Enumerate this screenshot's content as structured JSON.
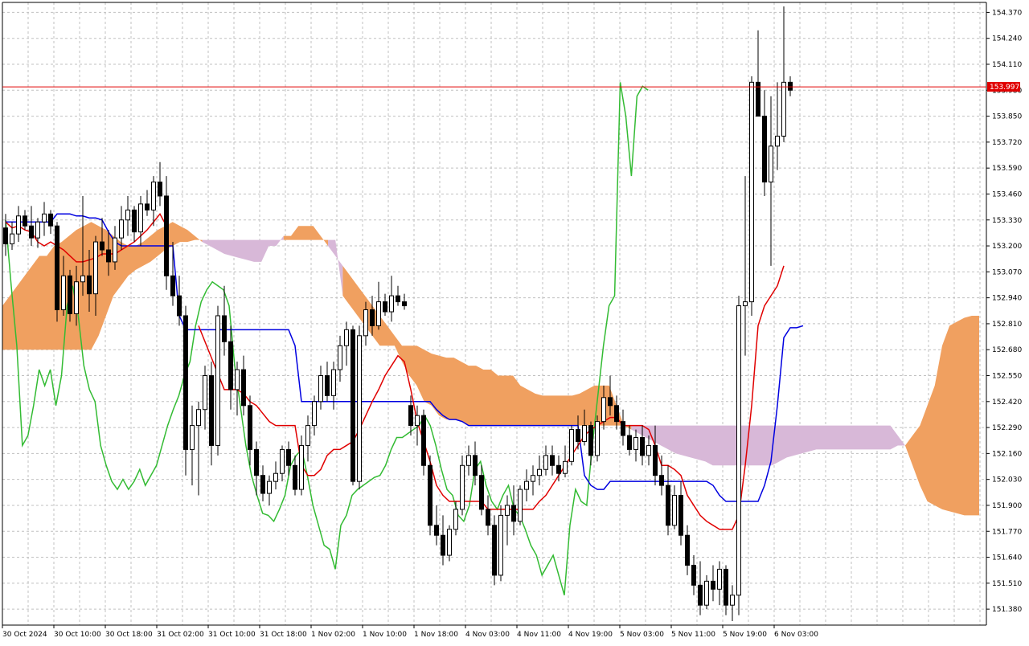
{
  "chart_data": {
    "type": "candlestick",
    "indicator": "ichimoku",
    "grid": true,
    "ylim": [
      151.3,
      154.42
    ],
    "y_ticks": [
      "154.370",
      "154.240",
      "154.110",
      "153.980",
      "153.850",
      "153.720",
      "153.590",
      "153.460",
      "153.330",
      "153.200",
      "153.070",
      "152.940",
      "152.810",
      "152.680",
      "152.550",
      "152.420",
      "152.290",
      "152.160",
      "152.030",
      "151.900",
      "151.770",
      "151.640",
      "151.510",
      "151.380"
    ],
    "x_ticks": [
      "30 Oct 2024",
      "30 Oct 10:00",
      "30 Oct 18:00",
      "31 Oct 02:00",
      "31 Oct 10:00",
      "31 Oct 18:00",
      "1 Nov 02:00",
      "1 Nov 10:00",
      "1 Nov 18:00",
      "4 Nov 03:00",
      "4 Nov 11:00",
      "4 Nov 19:00",
      "5 Nov 03:00",
      "5 Nov 11:00",
      "5 Nov 19:00",
      "6 Nov 03:00"
    ],
    "current_price": 153.997,
    "current_price_label": "153.997",
    "colors": {
      "tenkan": "#e00000",
      "kijun": "#0000e0",
      "chikou": "#33bb33",
      "cloud_bull": "#f0a060",
      "cloud_bear": "#d8b8d8",
      "price_line": "#e00000",
      "candle": "#000000",
      "grid": "#c0c0c0"
    },
    "candles": [
      [
        153.29,
        153.36,
        153.15,
        153.21
      ],
      [
        153.21,
        153.32,
        153.18,
        153.26
      ],
      [
        153.26,
        153.4,
        153.22,
        153.35
      ],
      [
        153.35,
        153.38,
        153.28,
        153.3
      ],
      [
        153.3,
        153.4,
        153.2,
        153.24
      ],
      [
        153.24,
        153.34,
        153.19,
        153.32
      ],
      [
        153.32,
        153.42,
        153.25,
        153.36
      ],
      [
        153.36,
        153.38,
        153.26,
        153.3
      ],
      [
        153.3,
        153.32,
        152.82,
        152.88
      ],
      [
        152.88,
        153.15,
        152.85,
        153.05
      ],
      [
        153.05,
        153.08,
        152.82,
        152.86
      ],
      [
        152.86,
        153.1,
        152.8,
        153.02
      ],
      [
        153.02,
        153.45,
        152.95,
        153.05
      ],
      [
        153.05,
        153.18,
        152.87,
        152.96
      ],
      [
        152.96,
        153.25,
        152.85,
        153.22
      ],
      [
        153.22,
        153.34,
        153.15,
        153.18
      ],
      [
        153.18,
        153.28,
        153.05,
        153.12
      ],
      [
        153.12,
        153.3,
        153.08,
        153.24
      ],
      [
        153.24,
        153.4,
        153.18,
        153.33
      ],
      [
        153.33,
        153.45,
        153.25,
        153.38
      ],
      [
        153.38,
        153.4,
        153.22,
        153.27
      ],
      [
        153.27,
        153.45,
        153.2,
        153.41
      ],
      [
        153.41,
        153.48,
        153.35,
        153.38
      ],
      [
        153.38,
        153.55,
        153.3,
        153.52
      ],
      [
        153.52,
        153.62,
        153.4,
        153.45
      ],
      [
        153.45,
        153.55,
        152.98,
        153.05
      ],
      [
        153.05,
        153.22,
        152.9,
        152.95
      ],
      [
        152.95,
        153.05,
        152.8,
        152.85
      ],
      [
        152.85,
        152.9,
        152.05,
        152.18
      ],
      [
        152.18,
        152.4,
        152.0,
        152.3
      ],
      [
        152.3,
        152.42,
        151.95,
        152.38
      ],
      [
        152.38,
        152.6,
        152.28,
        152.55
      ],
      [
        152.55,
        152.62,
        152.1,
        152.2
      ],
      [
        152.2,
        152.9,
        152.15,
        152.85
      ],
      [
        152.85,
        153.0,
        152.65,
        152.72
      ],
      [
        152.72,
        152.8,
        152.38,
        152.48
      ],
      [
        152.48,
        152.62,
        152.35,
        152.58
      ],
      [
        152.58,
        152.65,
        152.35,
        152.4
      ],
      [
        152.4,
        152.45,
        152.1,
        152.18
      ],
      [
        152.18,
        152.22,
        151.95,
        152.05
      ],
      [
        152.05,
        152.1,
        151.92,
        151.96
      ],
      [
        151.96,
        152.05,
        151.9,
        152.02
      ],
      [
        152.02,
        152.12,
        151.98,
        152.06
      ],
      [
        152.06,
        152.2,
        152.02,
        152.18
      ],
      [
        152.18,
        152.22,
        152.05,
        152.1
      ],
      [
        152.1,
        152.15,
        151.95,
        151.98
      ],
      [
        151.98,
        152.25,
        151.95,
        152.2
      ],
      [
        152.2,
        152.35,
        152.12,
        152.3
      ],
      [
        152.3,
        152.45,
        152.25,
        152.42
      ],
      [
        152.42,
        152.6,
        152.38,
        152.55
      ],
      [
        152.55,
        152.62,
        152.42,
        152.45
      ],
      [
        152.45,
        152.62,
        152.38,
        152.58
      ],
      [
        152.58,
        152.75,
        152.52,
        152.7
      ],
      [
        152.7,
        152.82,
        152.6,
        152.78
      ],
      [
        152.78,
        152.8,
        152.0,
        152.02
      ],
      [
        152.02,
        152.8,
        151.98,
        152.75
      ],
      [
        152.75,
        152.92,
        152.7,
        152.88
      ],
      [
        152.88,
        152.95,
        152.75,
        152.8
      ],
      [
        152.8,
        153.02,
        152.78,
        152.92
      ],
      [
        152.92,
        152.96,
        152.85,
        152.87
      ],
      [
        152.87,
        153.05,
        152.82,
        152.95
      ],
      [
        152.95,
        153.0,
        152.9,
        152.92
      ],
      [
        152.92,
        152.96,
        152.88,
        152.9
      ],
      [
        152.4,
        152.45,
        152.25,
        152.3
      ],
      [
        152.3,
        152.4,
        152.2,
        152.35
      ],
      [
        152.35,
        152.38,
        152.05,
        152.1
      ],
      [
        152.1,
        152.15,
        151.75,
        151.8
      ],
      [
        151.8,
        151.9,
        151.7,
        151.75
      ],
      [
        151.75,
        151.85,
        151.6,
        151.65
      ],
      [
        151.65,
        151.8,
        151.62,
        151.78
      ],
      [
        151.78,
        151.92,
        151.75,
        151.88
      ],
      [
        151.88,
        152.15,
        151.85,
        152.1
      ],
      [
        152.1,
        152.2,
        152.05,
        152.15
      ],
      [
        152.15,
        152.22,
        152.0,
        152.05
      ],
      [
        152.05,
        152.1,
        151.85,
        151.88
      ],
      [
        151.88,
        151.95,
        151.75,
        151.8
      ],
      [
        151.8,
        151.85,
        151.5,
        151.55
      ],
      [
        151.55,
        151.9,
        151.52,
        151.85
      ],
      [
        151.85,
        151.95,
        151.7,
        151.9
      ],
      [
        151.9,
        152.0,
        151.75,
        151.82
      ],
      [
        151.82,
        152.0,
        151.8,
        151.98
      ],
      [
        151.98,
        152.08,
        151.92,
        152.02
      ],
      [
        152.02,
        152.1,
        151.95,
        152.05
      ],
      [
        152.05,
        152.15,
        152.0,
        152.08
      ],
      [
        152.08,
        152.2,
        152.05,
        152.15
      ],
      [
        152.15,
        152.2,
        152.05,
        152.1
      ],
      [
        152.1,
        152.15,
        152.02,
        152.06
      ],
      [
        152.06,
        152.2,
        152.04,
        152.12
      ],
      [
        152.12,
        152.3,
        152.1,
        152.28
      ],
      [
        152.28,
        152.35,
        152.18,
        152.22
      ],
      [
        152.22,
        152.38,
        152.2,
        152.3
      ],
      [
        152.3,
        152.32,
        152.1,
        152.15
      ],
      [
        152.15,
        152.35,
        152.12,
        152.32
      ],
      [
        152.32,
        152.5,
        152.28,
        152.44
      ],
      [
        152.44,
        152.55,
        152.35,
        152.4
      ],
      [
        152.4,
        152.45,
        152.28,
        152.32
      ],
      [
        152.32,
        152.38,
        152.2,
        152.25
      ],
      [
        152.25,
        152.3,
        152.15,
        152.18
      ],
      [
        152.18,
        152.28,
        152.12,
        152.24
      ],
      [
        152.24,
        152.3,
        152.1,
        152.15
      ],
      [
        152.15,
        152.25,
        152.1,
        152.2
      ],
      [
        152.2,
        152.3,
        152.0,
        152.05
      ],
      [
        152.05,
        152.15,
        151.95,
        152.0
      ],
      [
        152.0,
        152.1,
        151.75,
        151.8
      ],
      [
        151.8,
        152.0,
        151.78,
        151.95
      ],
      [
        151.95,
        152.02,
        151.7,
        151.75
      ],
      [
        151.75,
        151.8,
        151.55,
        151.6
      ],
      [
        151.6,
        151.65,
        151.45,
        151.5
      ],
      [
        151.5,
        151.62,
        151.35,
        151.4
      ],
      [
        151.4,
        151.55,
        151.38,
        151.52
      ],
      [
        151.52,
        151.6,
        151.42,
        151.48
      ],
      [
        151.48,
        151.62,
        151.4,
        151.58
      ],
      [
        151.58,
        151.6,
        151.35,
        151.4
      ],
      [
        151.4,
        151.5,
        151.32,
        151.45
      ],
      [
        151.45,
        152.95,
        151.35,
        152.9
      ],
      [
        152.9,
        153.55,
        152.65,
        152.92
      ],
      [
        152.92,
        154.05,
        152.85,
        154.02
      ],
      [
        154.02,
        154.28,
        153.85,
        153.85
      ],
      [
        153.85,
        153.98,
        153.45,
        153.52
      ],
      [
        153.52,
        153.95,
        153.1,
        153.7
      ],
      [
        153.7,
        154.02,
        153.58,
        153.75
      ],
      [
        153.75,
        154.4,
        153.72,
        154.02
      ],
      [
        154.02,
        154.05,
        153.95,
        153.98
      ]
    ],
    "tenkan": [
      153.32,
      153.29,
      153.3,
      153.28,
      153.27,
      153.22,
      153.2,
      153.22,
      153.2,
      153.18,
      153.15,
      153.12,
      153.12,
      153.13,
      153.14,
      153.16,
      153.16,
      153.16,
      153.18,
      153.2,
      153.22,
      153.25,
      153.28,
      153.32,
      153.36,
      153.3,
      null,
      null,
      null,
      null,
      152.8,
      152.72,
      152.64,
      152.56,
      152.48,
      152.48,
      152.48,
      152.46,
      152.42,
      152.4,
      152.36,
      152.32,
      152.3,
      152.3,
      152.3,
      152.3,
      152.1,
      152.05,
      152.05,
      152.08,
      152.15,
      152.18,
      152.18,
      152.2,
      152.22,
      152.28,
      152.35,
      152.42,
      152.48,
      152.55,
      152.6,
      152.65,
      152.62,
      152.48,
      152.32,
      152.22,
      152.12,
      152.0,
      151.95,
      151.92,
      151.92,
      151.92,
      151.92,
      151.92,
      151.92,
      151.88,
      151.88,
      151.88,
      151.88,
      151.88,
      151.88,
      151.88,
      151.88,
      151.92,
      151.95,
      152.0,
      152.05,
      152.1,
      152.15,
      152.2,
      152.25,
      152.28,
      152.3,
      152.32,
      152.34,
      152.34,
      152.3,
      152.3,
      152.3,
      152.3,
      152.28,
      152.2,
      152.1,
      152.1,
      152.08,
      152.05,
      151.95,
      151.9,
      151.85,
      151.82,
      151.8,
      151.78,
      151.78,
      151.78,
      151.85,
      152.1,
      152.4,
      152.8,
      152.9,
      152.95,
      153.0,
      153.1,
      null
    ],
    "kijun": [
      153.32,
      153.32,
      153.32,
      153.32,
      153.32,
      153.32,
      153.32,
      153.32,
      153.36,
      153.36,
      153.36,
      153.35,
      153.35,
      153.34,
      153.34,
      153.33,
      153.27,
      153.22,
      153.2,
      153.2,
      153.2,
      153.2,
      153.2,
      153.2,
      153.2,
      153.2,
      153.2,
      152.85,
      152.78,
      152.78,
      152.78,
      152.78,
      152.78,
      152.78,
      152.78,
      152.78,
      152.78,
      152.78,
      152.78,
      152.78,
      152.78,
      152.78,
      152.78,
      152.78,
      152.78,
      152.7,
      152.42,
      152.42,
      152.42,
      152.42,
      152.42,
      152.42,
      152.42,
      152.42,
      152.42,
      152.42,
      152.42,
      152.42,
      152.42,
      152.42,
      152.42,
      152.42,
      152.42,
      152.42,
      152.42,
      152.42,
      152.42,
      152.38,
      152.35,
      152.33,
      152.33,
      152.32,
      152.3,
      152.3,
      152.3,
      152.3,
      152.3,
      152.3,
      152.3,
      152.3,
      152.3,
      152.3,
      152.3,
      152.3,
      152.3,
      152.3,
      152.3,
      152.3,
      152.3,
      152.3,
      152.05,
      152.0,
      151.98,
      151.98,
      152.02,
      152.02,
      152.02,
      152.02,
      152.02,
      152.02,
      152.02,
      152.02,
      152.02,
      152.02,
      152.02,
      152.02,
      152.02,
      152.02,
      152.02,
      152.02,
      152.0,
      151.95,
      151.92,
      151.92,
      151.92,
      151.92,
      151.92,
      151.92,
      152.0,
      152.12,
      152.4,
      152.74,
      152.79,
      152.79,
      152.8
    ],
    "chikou": [
      153.33,
      153.0,
      152.7,
      152.2,
      152.25,
      152.4,
      152.58,
      152.5,
      152.58,
      152.4,
      152.55,
      152.9,
      153.0,
      152.85,
      152.6,
      152.48,
      152.42,
      152.2,
      152.1,
      152.02,
      151.98,
      152.03,
      151.98,
      152.02,
      152.08,
      152.0,
      152.05,
      152.1,
      152.2,
      152.3,
      152.38,
      152.45,
      152.55,
      152.62,
      152.8,
      152.92,
      152.98,
      153.02,
      153.0,
      152.98,
      152.9,
      152.6,
      152.4,
      152.2,
      152.05,
      151.95,
      151.86,
      151.85,
      151.82,
      151.88,
      151.95,
      152.1,
      152.15,
      152.18,
      152.05,
      151.9,
      151.8,
      151.7,
      151.68,
      151.58,
      151.8,
      151.85,
      151.95,
      151.98,
      152.0,
      152.02,
      152.04,
      152.05,
      152.1,
      152.18,
      152.24,
      152.24,
      152.26,
      152.28,
      152.3,
      152.35,
      152.3,
      152.2,
      152.08,
      151.98,
      151.95,
      151.85,
      151.82,
      151.9,
      152.08,
      152.12,
      152.0,
      151.92,
      151.88,
      151.95,
      152.0,
      151.88,
      151.85,
      151.78,
      151.7,
      151.65,
      151.55,
      151.6,
      151.65,
      151.55,
      151.45,
      151.8,
      151.98,
      151.92,
      151.9,
      152.2,
      152.45,
      152.7,
      152.9,
      152.95,
      154.02,
      153.85,
      153.55,
      153.95,
      154.0,
      153.98
    ],
    "span_a": [
      152.9,
      152.95,
      153.0,
      153.05,
      153.1,
      153.15,
      153.15,
      153.2,
      153.22,
      153.25,
      153.28,
      153.3,
      153.32,
      153.3,
      153.28,
      153.25,
      153.22,
      153.2,
      153.2,
      153.22,
      153.25,
      153.28,
      153.3,
      153.32,
      153.3,
      153.28,
      153.25,
      153.22,
      153.2,
      153.18,
      153.16,
      153.15,
      153.14,
      153.13,
      153.12,
      153.12,
      153.2,
      153.2,
      153.25,
      153.25,
      153.3,
      153.3,
      153.3,
      153.25,
      153.2,
      153.15,
      153.1,
      153.05,
      153.0,
      152.95,
      152.9,
      152.85,
      152.8,
      152.75,
      152.7,
      152.7,
      152.7,
      152.68,
      152.66,
      152.65,
      152.64,
      152.64,
      152.62,
      152.6,
      152.6,
      152.58,
      152.58,
      152.55,
      152.55,
      152.55,
      152.5,
      152.48,
      152.46,
      152.45,
      152.45,
      152.45,
      152.45,
      152.45,
      152.46,
      152.48,
      152.5,
      152.5,
      152.5,
      152.4,
      152.3,
      152.28,
      152.26,
      152.24,
      152.22,
      152.2,
      152.18,
      152.16,
      152.15,
      152.14,
      152.13,
      152.12,
      152.1,
      152.1,
      152.1,
      152.1,
      152.1,
      152.1,
      152.1,
      152.1,
      152.1,
      152.12,
      152.14,
      152.15,
      152.16,
      152.17,
      152.18,
      152.18,
      152.18,
      152.18,
      152.18,
      152.18,
      152.18,
      152.18,
      152.18,
      152.18,
      152.18,
      152.2,
      152.2,
      152.25,
      152.3,
      152.4,
      152.5,
      152.7,
      152.8,
      152.82,
      152.84,
      152.85,
      152.85
    ],
    "span_b": [
      152.68,
      152.68,
      152.68,
      152.68,
      152.68,
      152.68,
      152.68,
      152.68,
      152.68,
      152.68,
      152.68,
      152.68,
      152.68,
      152.75,
      152.85,
      152.95,
      153.0,
      153.05,
      153.08,
      153.1,
      153.12,
      153.15,
      153.18,
      153.2,
      153.22,
      153.22,
      153.23,
      153.23,
      153.23,
      153.23,
      153.23,
      153.23,
      153.23,
      153.23,
      153.23,
      153.23,
      153.23,
      153.23,
      153.23,
      153.23,
      153.23,
      153.23,
      153.23,
      153.23,
      153.23,
      153.23,
      152.95,
      152.9,
      152.85,
      152.8,
      152.75,
      152.7,
      152.7,
      152.7,
      152.62,
      152.55,
      152.5,
      152.42,
      152.4,
      152.35,
      152.33,
      152.33,
      152.32,
      152.3,
      152.3,
      152.3,
      152.3,
      152.3,
      152.3,
      152.3,
      152.3,
      152.3,
      152.3,
      152.3,
      152.3,
      152.3,
      152.3,
      152.3,
      152.3,
      152.3,
      152.3,
      152.3,
      152.3,
      152.3,
      152.3,
      152.3,
      152.3,
      152.3,
      152.3,
      152.3,
      152.3,
      152.3,
      152.3,
      152.3,
      152.3,
      152.3,
      152.3,
      152.3,
      152.3,
      152.3,
      152.3,
      152.3,
      152.3,
      152.3,
      152.3,
      152.3,
      152.3,
      152.3,
      152.3,
      152.3,
      152.3,
      152.3,
      152.3,
      152.3,
      152.3,
      152.3,
      152.3,
      152.3,
      152.3,
      152.3,
      152.3,
      152.25,
      152.2,
      152.1,
      152.0,
      151.92,
      151.9,
      151.88,
      151.87,
      151.86,
      151.85,
      151.85,
      151.85
    ]
  }
}
